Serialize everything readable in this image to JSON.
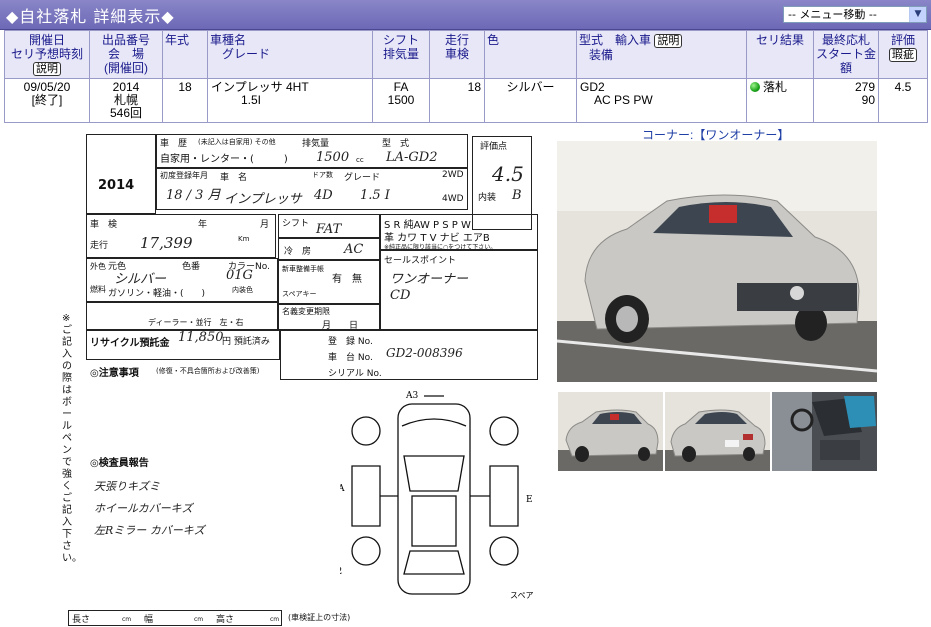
{
  "header": {
    "title": "◆自社落札 詳細表示◆",
    "menu_select": "-- メニュー移動 --"
  },
  "table": {
    "headers": {
      "date": [
        "開催日",
        "セリ予想時刻"
      ],
      "date_btn": "説明",
      "lot": [
        "出品番号",
        "会　場",
        "(開催回)"
      ],
      "year": "年式",
      "model": [
        "車種名",
        "グレード"
      ],
      "shift": [
        "シフト",
        "排気量"
      ],
      "mileage": [
        "走行",
        "車検"
      ],
      "color": "色",
      "type": [
        "型式　輸入車",
        "装備"
      ],
      "type_btn": "説明",
      "result": "セリ結果",
      "price": [
        "最終応札",
        "スタート金額"
      ],
      "score": "評価",
      "score_btn": "瑕疵"
    },
    "row": {
      "date": "09/05/20",
      "date_status": "[終了]",
      "lot_year": "2014",
      "venue": "札幌",
      "session": "546回",
      "year": "18",
      "model": "インプレッサ 4HT",
      "grade": "1.5I",
      "shift": "FA",
      "displacement": "1500",
      "mileage": "18",
      "color": "シルバー",
      "type": "GD2",
      "equipment": "AC PS PW",
      "result": "落札",
      "price_final": "279",
      "price_start": "90",
      "score": "4.5"
    }
  },
  "sheet": {
    "lot_number": "2014",
    "car_history_label": "車　歴",
    "car_history_note": "(未記入は自家用) その他",
    "car_history_value": "自家用・レンター・(　　　)",
    "displacement_label": "排気量",
    "displacement_value": "1500",
    "displacement_unit": "cc",
    "model_label": "型　式",
    "model_value": "LA-GD2",
    "score_label": "評価点",
    "score_value": "4.5",
    "reg_label": "初度登録年月",
    "reg_value": "18 / 3 月",
    "name_label": "車　名",
    "name_value": "インプレッサ",
    "doors_label": "ドア数",
    "doors_value": "4D",
    "grade_label": "グレード",
    "grade_value": "1.5 I",
    "drive_2wd": "2WD",
    "drive_4wd": "4WD",
    "interior_label": "内装",
    "interior_value": "B",
    "inspection_label": "車　検",
    "year_label": "年",
    "month_label": "月",
    "mileage_label": "走行",
    "mileage_value": "17,399",
    "mileage_unit": "Km",
    "shift_label": "シフト",
    "shift_value": "FAT",
    "ac_label": "冷　房",
    "ac_value": "AC",
    "equip_row1": "S R 純AW P S P W",
    "equip_row2": "革 カワ T V ナビ エアB",
    "equip_note": "※純正品に限り該当に○をつけて下さい。",
    "color_label": "外色",
    "orig_color_label": "元色",
    "color_no_label": "色番",
    "color_value": "シルバー",
    "color_code_label": "カラーNo.",
    "color_code": "01G",
    "interior_color_label": "内装色",
    "fuel_label": "燃料",
    "fuel_value": "ガソリン・軽油・(　　)",
    "manual_label": "新車整備手帳",
    "manual_value": "有　無",
    "spare_label": "スペアキー",
    "dealer_label": "ディーラー・並行　左・右",
    "recycle_label": "リサイクル預託金",
    "recycle_value": "11,850",
    "recycle_unit": "円 預託済み",
    "notes_label": "◎注意事項",
    "notes_sub": "(修復・不具合箇所および改善策)",
    "name_change_label": "名義変更期限",
    "name_change_value": "月　　日",
    "reg_no_label": "登　録 No.",
    "chassis_label": "車　台 No.",
    "chassis_value": "GD2-008396",
    "serial_label": "シリアル No.",
    "selling_label": "セールスポイント",
    "selling_1": "ワンオーナー",
    "selling_2": "CD",
    "report_label": "◎検査員報告",
    "report_1": "天張りキズミ",
    "report_2": "ホイールカバーキズ",
    "report_3": "左Rミラー カバーキズ",
    "vertical_note": "※ご記入の際はボールペンで強くご記入下さい。",
    "footer_length": "長さ",
    "footer_width": "幅",
    "footer_height": "高さ",
    "footer_unit": "cm",
    "footer_note": "(車検証上の寸法)",
    "spare_tire": "スペア",
    "diag_a3": "A3",
    "diag_a": "A",
    "diag_e": "E",
    "diag_a2": "A2"
  },
  "photos": {
    "corner_label": "コーナー:【ワンオーナー】"
  }
}
